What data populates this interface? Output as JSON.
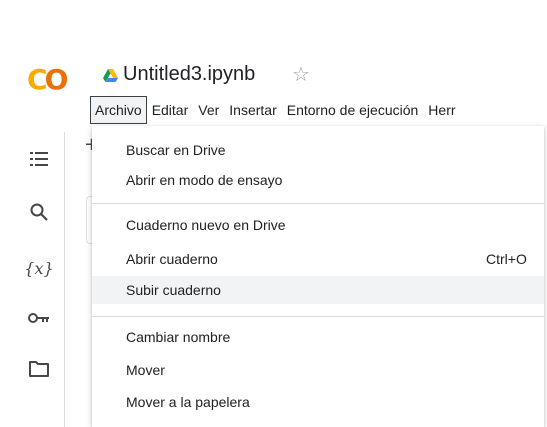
{
  "logo": {
    "part1": "C",
    "part2": "O"
  },
  "header": {
    "file_title": "Untitled3.ipynb",
    "star": "☆"
  },
  "menubar": [
    {
      "label": "Archivo",
      "active": true
    },
    {
      "label": "Editar"
    },
    {
      "label": "Ver"
    },
    {
      "label": "Insertar"
    },
    {
      "label": "Entorno de ejecución"
    },
    {
      "label": "Herr"
    }
  ],
  "toolbar": {
    "add_symbol": "+"
  },
  "sidebar": {
    "icons": [
      "toc-icon",
      "search-icon",
      "variables-icon",
      "secrets-key-icon",
      "folder-icon"
    ],
    "variables_label": "{x}"
  },
  "menu": {
    "items": [
      {
        "label": "Buscar en Drive"
      },
      {
        "label": "Abrir en modo de ensayo"
      },
      {
        "label": "Cuaderno nuevo en Drive"
      },
      {
        "label": "Abrir cuaderno",
        "shortcut": "Ctrl+O"
      },
      {
        "label": "Subir cuaderno",
        "highlighted": true
      },
      {
        "label": "Cambiar nombre"
      },
      {
        "label": "Mover"
      },
      {
        "label": "Mover a la papelera"
      }
    ]
  },
  "colors": {
    "logo_orange": "#f9ab00",
    "logo_dark_orange": "#e8710a",
    "hover": "#f1f3f4"
  }
}
